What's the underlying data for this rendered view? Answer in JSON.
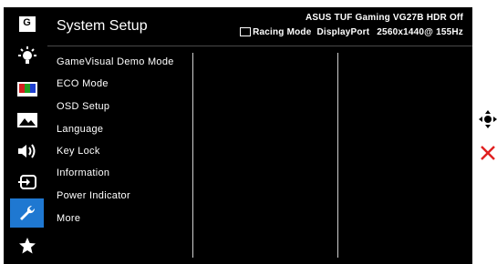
{
  "header": {
    "title": "System Setup",
    "model_info": "ASUS TUF Gaming  VG27B HDR Off",
    "mode": "Racing Mode",
    "input": "DisplayPort",
    "resolution": "2560x1440@ 155Hz"
  },
  "sidebar": {
    "items": [
      {
        "icon": "gamevisual-icon",
        "label": "G"
      },
      {
        "icon": "brightness-icon"
      },
      {
        "icon": "color-icon"
      },
      {
        "icon": "image-icon"
      },
      {
        "icon": "sound-icon"
      },
      {
        "icon": "input-select-icon"
      },
      {
        "icon": "wrench-icon",
        "active": true
      },
      {
        "icon": "favorite-star-icon"
      }
    ]
  },
  "menu": {
    "items": [
      "GameVisual Demo Mode",
      "ECO Mode",
      "OSD Setup",
      "Language",
      "Key Lock",
      "Information",
      "Power Indicator",
      "More"
    ]
  },
  "controls": {
    "navigate_icon": "joystick-icon",
    "exit_icon": "close-icon",
    "exit_color": "#e02020"
  },
  "colors": {
    "accent": "#1f78d1",
    "background": "#000000"
  }
}
